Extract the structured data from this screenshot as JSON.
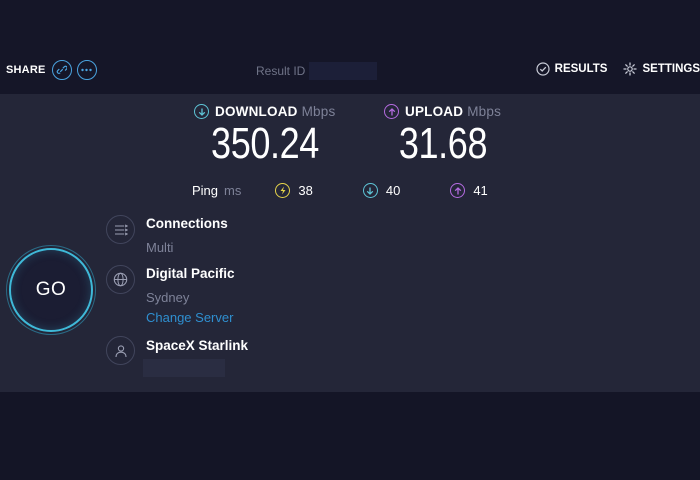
{
  "header": {
    "share_label": "SHARE",
    "share_icons": [
      "link-icon",
      "more-icon"
    ],
    "result_id_label": "Result ID",
    "results_label": "RESULTS",
    "settings_label": "SETTINGS"
  },
  "download": {
    "label": "DOWNLOAD",
    "unit": "Mbps",
    "value": "350.24"
  },
  "upload": {
    "label": "UPLOAD",
    "unit": "Mbps",
    "value": "31.68"
  },
  "ping": {
    "label": "Ping",
    "unit": "ms",
    "idle": "38",
    "download": "40",
    "upload": "41"
  },
  "go_label": "GO",
  "connections": {
    "title": "Connections",
    "value": "Multi"
  },
  "server": {
    "name": "Digital Pacific",
    "location": "Sydney",
    "change_label": "Change Server"
  },
  "provider": {
    "name": "SpaceX Starlink"
  },
  "colors": {
    "background": "#141526",
    "panel": "#242638",
    "download_accent": "#5ec4d6",
    "upload_accent": "#b46be0",
    "ping_accent": "#e6d44a",
    "link": "#2f8fd0",
    "go_ring": "#3fb9d8"
  }
}
